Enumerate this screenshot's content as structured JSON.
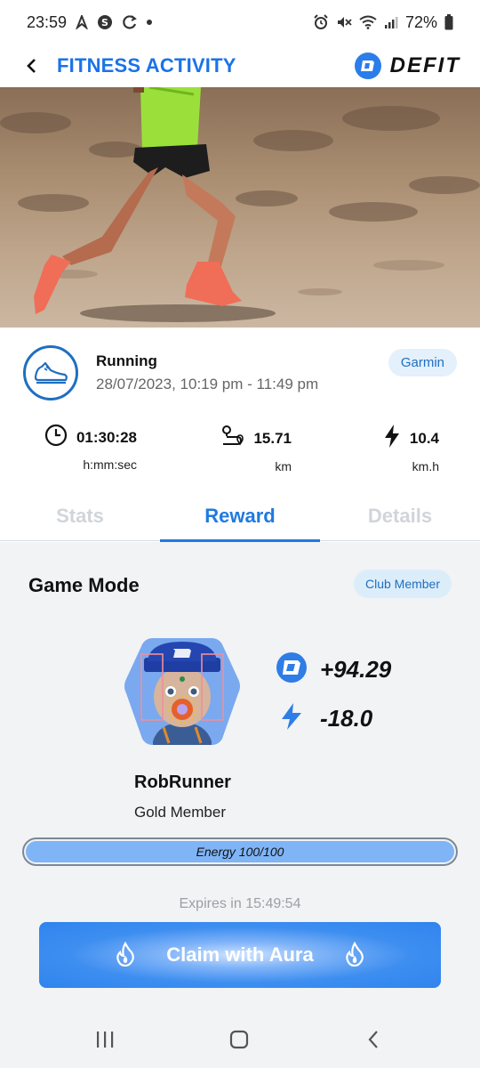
{
  "status_bar": {
    "time": "23:59",
    "battery": "72%"
  },
  "header": {
    "title": "FITNESS ACTIVITY",
    "brand": "DEFIT"
  },
  "activity": {
    "name": "Running",
    "datetime": "28/07/2023, 10:19 pm - 11:49 pm",
    "source": "Garmin"
  },
  "metrics": [
    {
      "icon": "clock-icon",
      "value": "01:30:28",
      "unit": "h:mm:sec"
    },
    {
      "icon": "route-icon",
      "value": "15.71",
      "unit": "km"
    },
    {
      "icon": "lightning-icon",
      "value": "10.4",
      "unit": "km.h"
    }
  ],
  "tabs": [
    {
      "label": "Stats",
      "active": false
    },
    {
      "label": "Reward",
      "active": true
    },
    {
      "label": "Details",
      "active": false
    }
  ],
  "game": {
    "title": "Game Mode",
    "badge": "Club Member",
    "token_reward": "+94.29",
    "energy_change": "-18.0",
    "user_name": "RobRunner",
    "user_tier": "Gold Member",
    "energy_label": "Energy 100/100",
    "energy_fraction": 1.0,
    "expires": "Expires in 15:49:54",
    "claim_label": "Claim with Aura"
  },
  "colors": {
    "accent": "#1f7ae0",
    "title_blue": "#1a73e8",
    "badge_bg": "#e4f0fb",
    "energy_fill": "#7fb4f6",
    "button_blue": "#2f84ee"
  }
}
